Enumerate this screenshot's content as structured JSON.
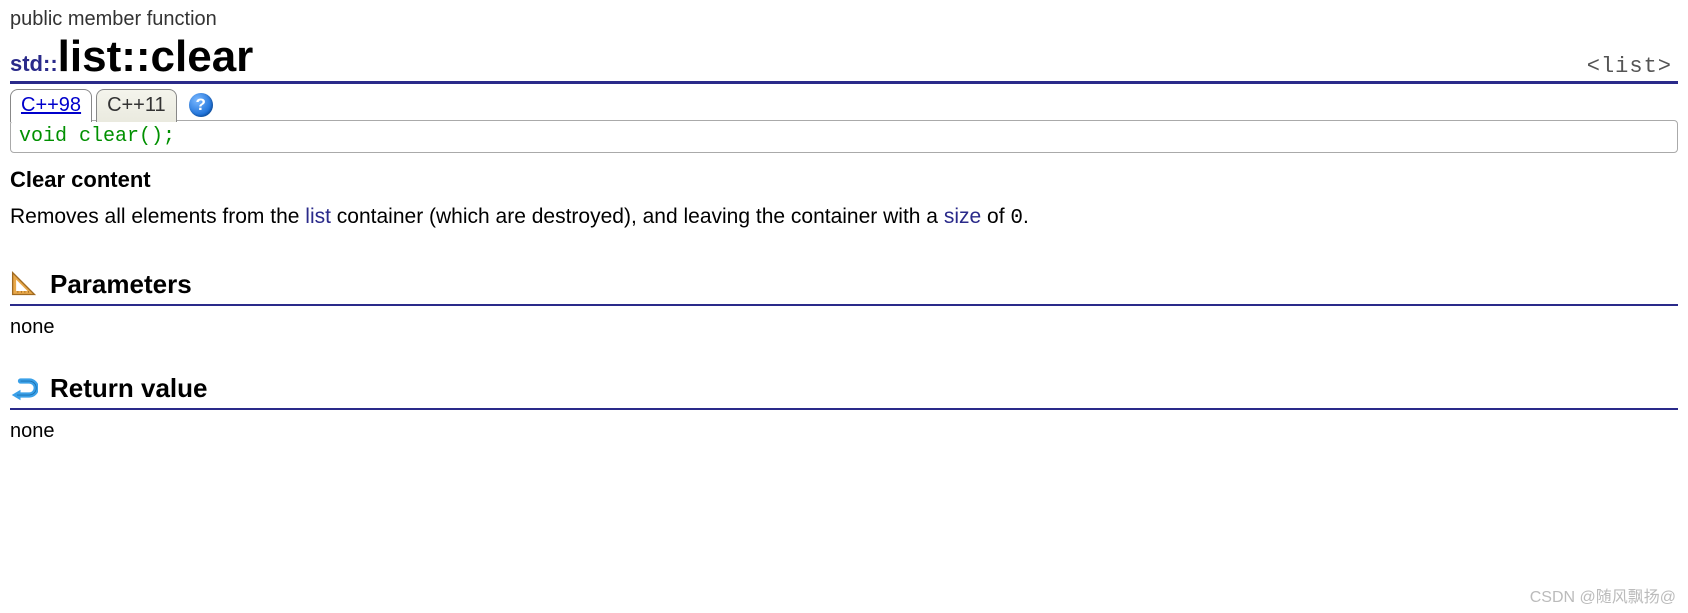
{
  "memberType": "public member function",
  "title": {
    "namespace": "std::",
    "class": "list",
    "separator": "::",
    "method": "clear"
  },
  "headerFile": "<list>",
  "tabs": {
    "active": "C++98",
    "inactive": "C++11"
  },
  "helpGlyph": "?",
  "signature": {
    "ret": "void",
    "rest": " clear();"
  },
  "brief": "Clear content",
  "description": {
    "pre": "Removes all elements from the ",
    "link1": "list",
    "mid": " container (which are destroyed), and leaving the container with a ",
    "link2": "size",
    "post": " of ",
    "zero": "0",
    "end": "."
  },
  "sections": {
    "parameters": {
      "title": "Parameters",
      "body": "none"
    },
    "returnValue": {
      "title": "Return value",
      "body": "none"
    }
  },
  "watermark": "CSDN @随风飘扬@"
}
